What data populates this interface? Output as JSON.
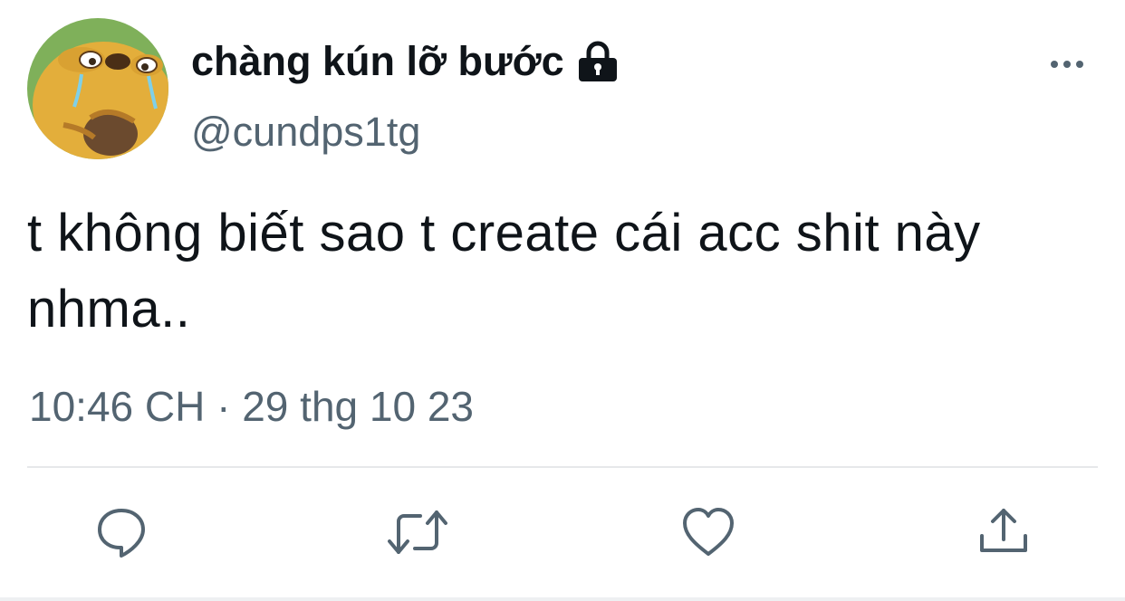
{
  "tweet": {
    "display_name": "chàng kún lỡ bước",
    "handle": "@cundps1tg",
    "text": "t không biết sao t create cái acc shit này nhma..",
    "timestamp": "10:46 CH · 29 thg 10 23"
  },
  "icons": {
    "avatar": "cartoon-dog-avatar",
    "protected": "lock-icon",
    "more": "more-horizontal-icon",
    "reply": "reply-bubble-icon",
    "retweet": "retweet-icon",
    "like": "heart-icon",
    "share": "share-upload-icon"
  },
  "colors": {
    "text_primary": "#0f1419",
    "text_secondary": "#536471",
    "icon_gray": "#536471",
    "divider": "#e6e8ea"
  }
}
